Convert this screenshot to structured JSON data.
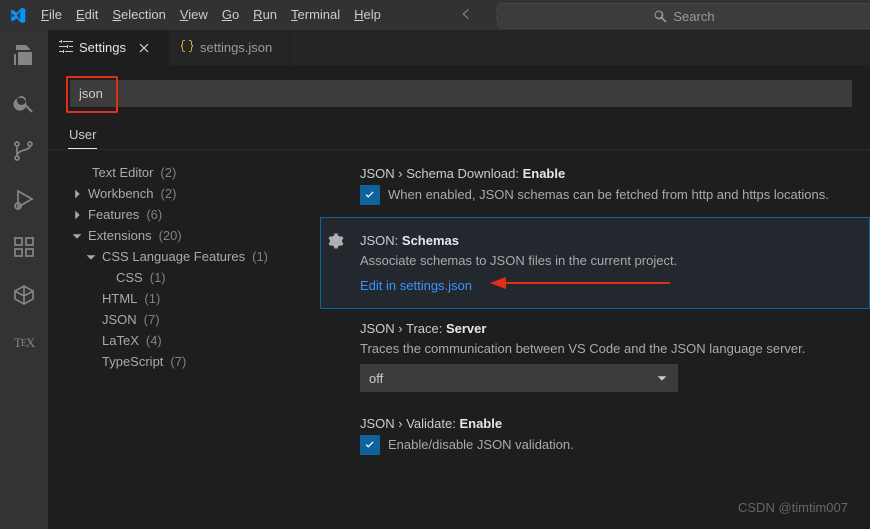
{
  "menubar": [
    "File",
    "Edit",
    "Selection",
    "View",
    "Go",
    "Run",
    "Terminal",
    "Help"
  ],
  "titlebar": {
    "search_placeholder": "Search"
  },
  "tabs": [
    {
      "id": "settings",
      "label": "Settings",
      "active": true,
      "icon": "sliders-icon"
    },
    {
      "id": "settingsjson",
      "label": "settings.json",
      "active": false,
      "icon": "braces-icon"
    }
  ],
  "settings_search": {
    "value": "json"
  },
  "scope_tabs": [
    {
      "label": "User",
      "active": true
    }
  ],
  "toc": [
    {
      "label": "Text Editor",
      "count": "(2)",
      "level": 0,
      "chev": "none"
    },
    {
      "label": "Workbench",
      "count": "(2)",
      "level": 0,
      "chev": "right"
    },
    {
      "label": "Features",
      "count": "(6)",
      "level": 0,
      "chev": "right"
    },
    {
      "label": "Extensions",
      "count": "(20)",
      "level": 0,
      "chev": "down"
    },
    {
      "label": "CSS Language Features",
      "count": "(1)",
      "level": 1,
      "chev": "down"
    },
    {
      "label": "CSS",
      "count": "(1)",
      "level": 2,
      "chev": ""
    },
    {
      "label": "HTML",
      "count": "(1)",
      "level": 1,
      "chev": ""
    },
    {
      "label": "JSON",
      "count": "(7)",
      "level": 1,
      "chev": ""
    },
    {
      "label": "LaTeX",
      "count": "(4)",
      "level": 1,
      "chev": ""
    },
    {
      "label": "TypeScript",
      "count": "(7)",
      "level": 1,
      "chev": ""
    }
  ],
  "details": {
    "schema_download": {
      "cat": "JSON › Schema Download: ",
      "name": "Enable",
      "desc": "When enabled, JSON schemas can be fetched from http and https locations.",
      "checked": true
    },
    "schemas": {
      "cat": "JSON: ",
      "name": "Schemas",
      "desc": "Associate schemas to JSON files in the current project.",
      "link": "Edit in settings.json"
    },
    "trace": {
      "cat": "JSON › Trace: ",
      "name": "Server",
      "desc": "Traces the communication between VS Code and the JSON language server.",
      "value": "off"
    },
    "validate": {
      "cat": "JSON › Validate: ",
      "name": "Enable",
      "desc": "Enable/disable JSON validation.",
      "checked": true
    }
  },
  "watermark": "CSDN @timtim007"
}
